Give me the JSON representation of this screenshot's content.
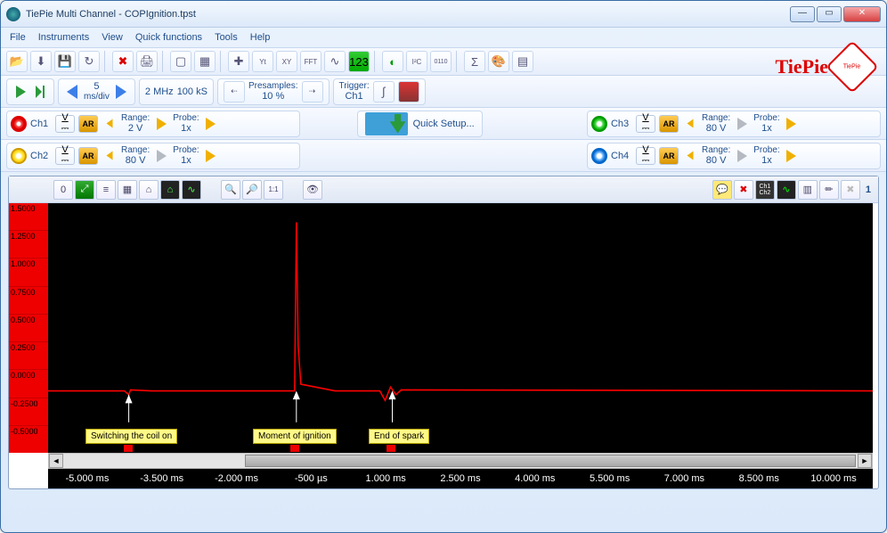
{
  "window": {
    "title": "TiePie Multi Channel - COPIgnition.tpst"
  },
  "menu": [
    "File",
    "Instruments",
    "View",
    "Quick functions",
    "Tools",
    "Help"
  ],
  "brand": {
    "text": "TiePie",
    "badge": "TiePie"
  },
  "timebase": {
    "value": "5",
    "unit": "ms/div",
    "sample_rate": "2 MHz",
    "record": "100 kS",
    "presamples_label": "Presamples:",
    "presamples": "10 %",
    "trigger_label": "Trigger:",
    "trigger_src": "Ch1"
  },
  "channels": [
    {
      "id": "ch1",
      "name": "Ch1",
      "color": "r",
      "ar": "AR",
      "range_label": "Range:",
      "range": "2 V",
      "probe_label": "Probe:",
      "probe": "1x",
      "active": true
    },
    {
      "id": "ch2",
      "name": "Ch2",
      "color": "y",
      "ar": "AR",
      "range_label": "Range:",
      "range": "80 V",
      "probe_label": "Probe:",
      "probe": "1x",
      "active": true
    },
    {
      "id": "ch3",
      "name": "Ch3",
      "color": "g",
      "ar": "AR",
      "range_label": "Range:",
      "range": "80 V",
      "probe_label": "Probe:",
      "probe": "1x",
      "active": false
    },
    {
      "id": "ch4",
      "name": "Ch4",
      "color": "b",
      "ar": "AR",
      "range_label": "Range:",
      "range": "80 V",
      "probe_label": "Probe:",
      "probe": "1x",
      "active": false
    }
  ],
  "quick_setup": "Quick Setup...",
  "chart_data": {
    "type": "line",
    "title": "",
    "xlabel": "",
    "ylabel": "",
    "ylim": [
      -0.5,
      1.5
    ],
    "yticks": [
      "1.5000",
      "1.2500",
      "1.0000",
      "0.7500",
      "0.5000",
      "0.2500",
      "0.0000",
      "-0.2500",
      "-0.5000"
    ],
    "xticks": [
      "-5.000 ms",
      "-3.500 ms",
      "-2.000 ms",
      "-500 µs",
      "1.000 ms",
      "2.500 ms",
      "4.000 ms",
      "5.500 ms",
      "7.000 ms",
      "8.500 ms",
      "10.000 ms"
    ],
    "series": [
      {
        "name": "Ch1",
        "color": "#ff0000"
      }
    ],
    "annotations": [
      {
        "text": "Switching the coil on",
        "x_ms": -3.6
      },
      {
        "text": "Moment of ignition",
        "x_ms": -0.3
      },
      {
        "text": "End of spark",
        "x_ms": 1.1
      }
    ]
  },
  "graph_toolbar_right_num": "1"
}
